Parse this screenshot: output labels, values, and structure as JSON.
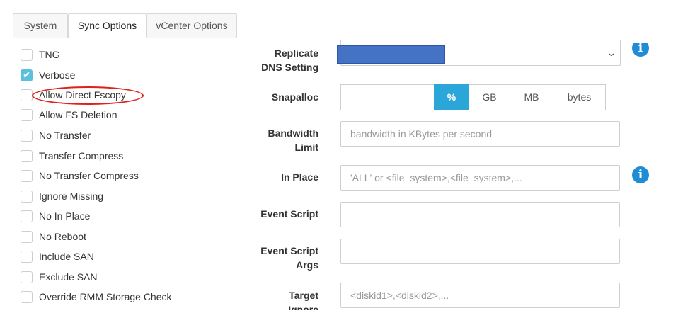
{
  "tabs": [
    {
      "label": "System",
      "active": false
    },
    {
      "label": "Sync Options",
      "active": true
    },
    {
      "label": "vCenter Options",
      "active": false
    }
  ],
  "options": [
    {
      "label": "TNG",
      "checked": false
    },
    {
      "label": "Verbose",
      "checked": true
    },
    {
      "label": "Allow Direct Fscopy",
      "checked": false,
      "highlighted": true
    },
    {
      "label": "Allow FS Deletion",
      "checked": false
    },
    {
      "label": "No Transfer",
      "checked": false
    },
    {
      "label": "Transfer Compress",
      "checked": false
    },
    {
      "label": "No Transfer Compress",
      "checked": false
    },
    {
      "label": "Ignore Missing",
      "checked": false
    },
    {
      "label": "No In Place",
      "checked": false
    },
    {
      "label": "No Reboot",
      "checked": false
    },
    {
      "label": "Include SAN",
      "checked": false
    },
    {
      "label": "Exclude SAN",
      "checked": false
    },
    {
      "label": "Override RMM Storage Check",
      "checked": false
    }
  ],
  "form": {
    "replicate_dns": {
      "label_line1": "Replicate",
      "label_line2": "DNS Setting"
    },
    "snapalloc": {
      "label": "Snapalloc",
      "value": "",
      "units": [
        "%",
        "GB",
        "MB",
        "bytes"
      ],
      "selected_unit": "%"
    },
    "bandwidth": {
      "label_line1": "Bandwidth",
      "label_line2": "Limit",
      "placeholder": "bandwidth in KBytes per second"
    },
    "in_place": {
      "label": "In Place",
      "placeholder": "'ALL' or <file_system>,<file_system>,..."
    },
    "event_script": {
      "label": "Event Script",
      "value": ""
    },
    "event_script_args": {
      "label_line1": "Event Script",
      "label_line2": "Args",
      "value": ""
    },
    "target_ignore": {
      "label_line1": "Target",
      "label_line2": "Ignore",
      "placeholder": "<diskid1>,<diskid2>,..."
    }
  },
  "colors": {
    "accent": "#2aa6d8",
    "checked": "#5bc0de",
    "info_icon": "#1f8dd6",
    "highlight": "#e0201b",
    "redaction": "#4472c4"
  },
  "icons": {
    "info": "info-icon",
    "chevron": "chevron-down-icon",
    "check": "check-icon"
  }
}
